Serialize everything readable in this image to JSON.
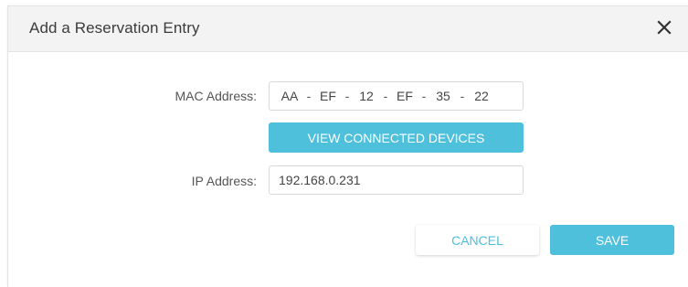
{
  "dialog": {
    "title": "Add a Reservation Entry",
    "close_icon": "close-icon"
  },
  "form": {
    "mac_label": "MAC Address:",
    "mac_segments": [
      "AA",
      "EF",
      "12",
      "EF",
      "35",
      "22"
    ],
    "mac_separator": "-",
    "view_devices_label": "VIEW CONNECTED DEVICES",
    "ip_label": "IP Address:",
    "ip_value": "192.168.0.231"
  },
  "actions": {
    "cancel_label": "CANCEL",
    "save_label": "SAVE"
  },
  "colors": {
    "accent": "#4ec0dc",
    "header_bg": "#f3f3f3",
    "text": "#555555"
  }
}
